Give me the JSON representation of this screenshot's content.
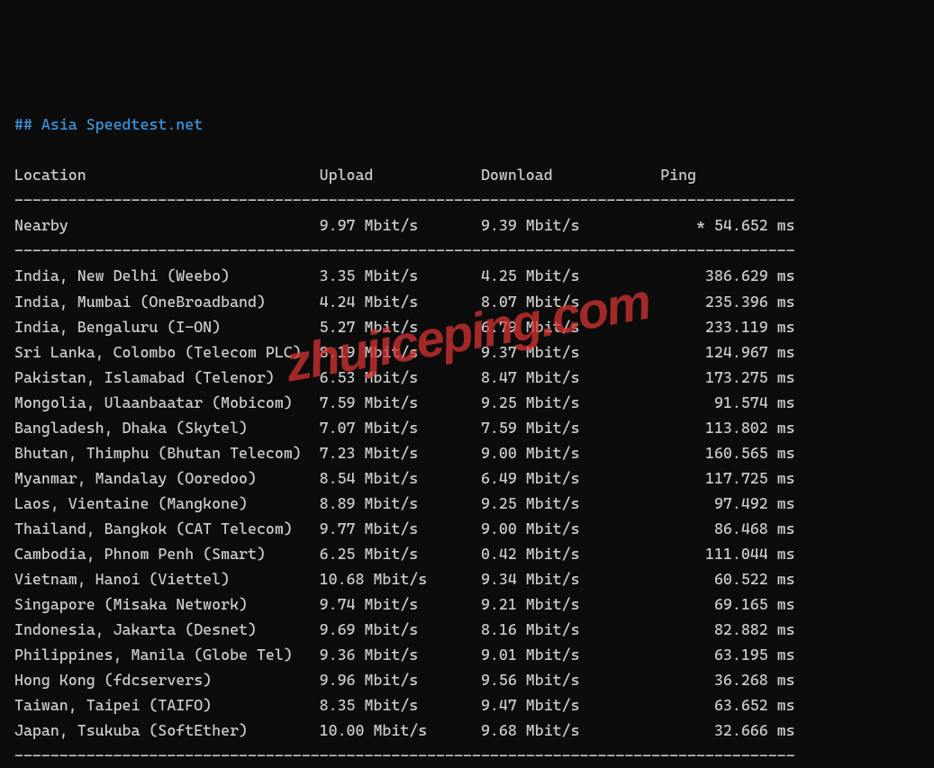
{
  "title": "## Asia Speedtest.net",
  "headers": {
    "location": "Location",
    "upload": "Upload",
    "download": "Download",
    "ping": "Ping"
  },
  "nearby": {
    "location": "Nearby",
    "upload": "9.97 Mbit/s",
    "download": "9.39 Mbit/s",
    "ping": "* 54.652 ms"
  },
  "rows": [
    {
      "location": "India, New Delhi (Weebo)",
      "upload": "3.35 Mbit/s",
      "download": "4.25 Mbit/s",
      "ping": "386.629 ms"
    },
    {
      "location": "India, Mumbai (OneBroadband)",
      "upload": "4.24 Mbit/s",
      "download": "8.07 Mbit/s",
      "ping": "235.396 ms"
    },
    {
      "location": "India, Bengaluru (I-ON)",
      "upload": "5.27 Mbit/s",
      "download": "6.79 Mbit/s",
      "ping": "233.119 ms"
    },
    {
      "location": "Sri Lanka, Colombo (Telecom PLC)",
      "upload": "8.19 Mbit/s",
      "download": "9.37 Mbit/s",
      "ping": "124.967 ms"
    },
    {
      "location": "Pakistan, Islamabad (Telenor)",
      "upload": "6.53 Mbit/s",
      "download": "8.47 Mbit/s",
      "ping": "173.275 ms"
    },
    {
      "location": "Mongolia, Ulaanbaatar (Mobicom)",
      "upload": "7.59 Mbit/s",
      "download": "9.25 Mbit/s",
      "ping": "91.574 ms"
    },
    {
      "location": "Bangladesh, Dhaka (Skytel)",
      "upload": "7.07 Mbit/s",
      "download": "7.59 Mbit/s",
      "ping": "113.802 ms"
    },
    {
      "location": "Bhutan, Thimphu (Bhutan Telecom)",
      "upload": "7.23 Mbit/s",
      "download": "9.00 Mbit/s",
      "ping": "160.565 ms"
    },
    {
      "location": "Myanmar, Mandalay (Ooredoo)",
      "upload": "8.54 Mbit/s",
      "download": "6.49 Mbit/s",
      "ping": "117.725 ms"
    },
    {
      "location": "Laos, Vientaine (Mangkone)",
      "upload": "8.89 Mbit/s",
      "download": "9.25 Mbit/s",
      "ping": "97.492 ms"
    },
    {
      "location": "Thailand, Bangkok (CAT Telecom)",
      "upload": "9.77 Mbit/s",
      "download": "9.00 Mbit/s",
      "ping": "86.468 ms"
    },
    {
      "location": "Cambodia, Phnom Penh (Smart)",
      "upload": "6.25 Mbit/s",
      "download": "0.42 Mbit/s",
      "ping": "111.044 ms"
    },
    {
      "location": "Vietnam, Hanoi (Viettel)",
      "upload": "10.68 Mbit/s",
      "download": "9.34 Mbit/s",
      "ping": "60.522 ms"
    },
    {
      "location": "Singapore (Misaka Network)",
      "upload": "9.74 Mbit/s",
      "download": "9.21 Mbit/s",
      "ping": "69.165 ms"
    },
    {
      "location": "Indonesia, Jakarta (Desnet)",
      "upload": "9.69 Mbit/s",
      "download": "8.16 Mbit/s",
      "ping": "82.882 ms"
    },
    {
      "location": "Philippines, Manila (Globe Tel)",
      "upload": "9.36 Mbit/s",
      "download": "9.01 Mbit/s",
      "ping": "63.195 ms"
    },
    {
      "location": "Hong Kong (fdcservers)",
      "upload": "9.96 Mbit/s",
      "download": "9.56 Mbit/s",
      "ping": "36.268 ms"
    },
    {
      "location": "Taiwan, Taipei (TAIFO)",
      "upload": "8.35 Mbit/s",
      "download": "9.47 Mbit/s",
      "ping": "63.652 ms"
    },
    {
      "location": "Japan, Tsukuba (SoftEther)",
      "upload": "10.00 Mbit/s",
      "download": "9.68 Mbit/s",
      "ping": "32.666 ms"
    }
  ],
  "watermark": "zhujiceping.com"
}
